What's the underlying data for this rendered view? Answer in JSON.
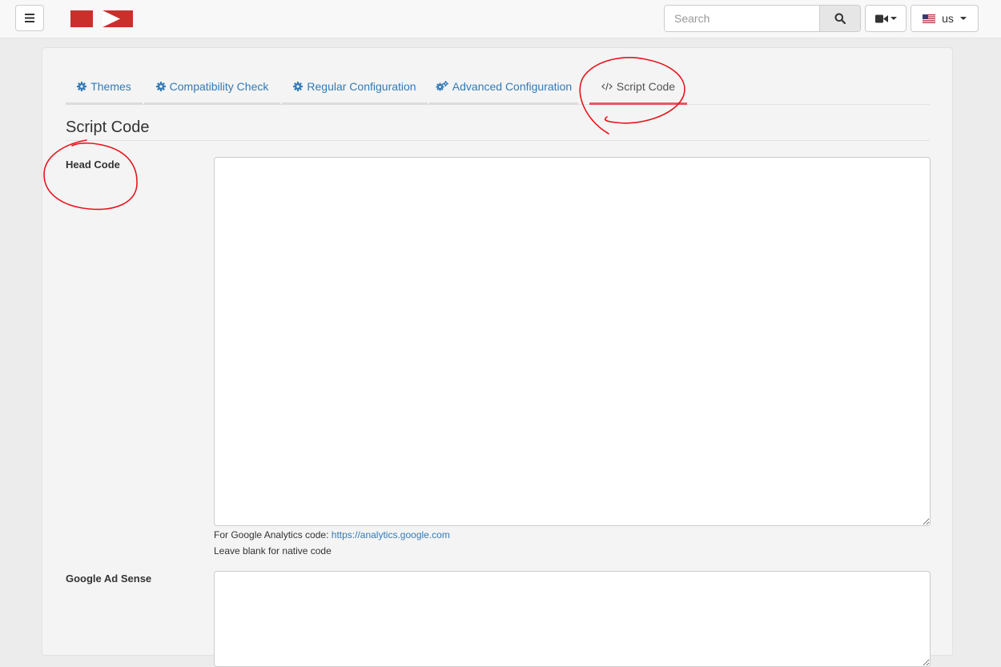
{
  "topbar": {
    "search": {
      "placeholder": "Search",
      "value": ""
    },
    "language": {
      "label": "us"
    }
  },
  "tabs": [
    {
      "label": "Themes",
      "icon": "gear-icon",
      "active": false
    },
    {
      "label": "Compatibility Check",
      "icon": "gear-icon",
      "active": false
    },
    {
      "label": "Regular Configuration",
      "icon": "gear-icon",
      "active": false
    },
    {
      "label": "Advanced Configuration",
      "icon": "gears-icon",
      "active": false
    },
    {
      "label": "Script Code",
      "icon": "code-icon",
      "active": true
    }
  ],
  "page": {
    "title": "Script Code",
    "head_code": {
      "label": "Head Code",
      "value": "",
      "help_prefix": "For Google Analytics code:",
      "help_link": "https://analytics.google.com",
      "help_note": "Leave blank for native code"
    },
    "ad_sense": {
      "label": "Google Ad Sense",
      "value": ""
    }
  },
  "colors": {
    "accent": "#337ab7",
    "active_tab_underline": "#ec5560",
    "logo_red": "#c9302c",
    "annotation_red": "#e8141b"
  }
}
